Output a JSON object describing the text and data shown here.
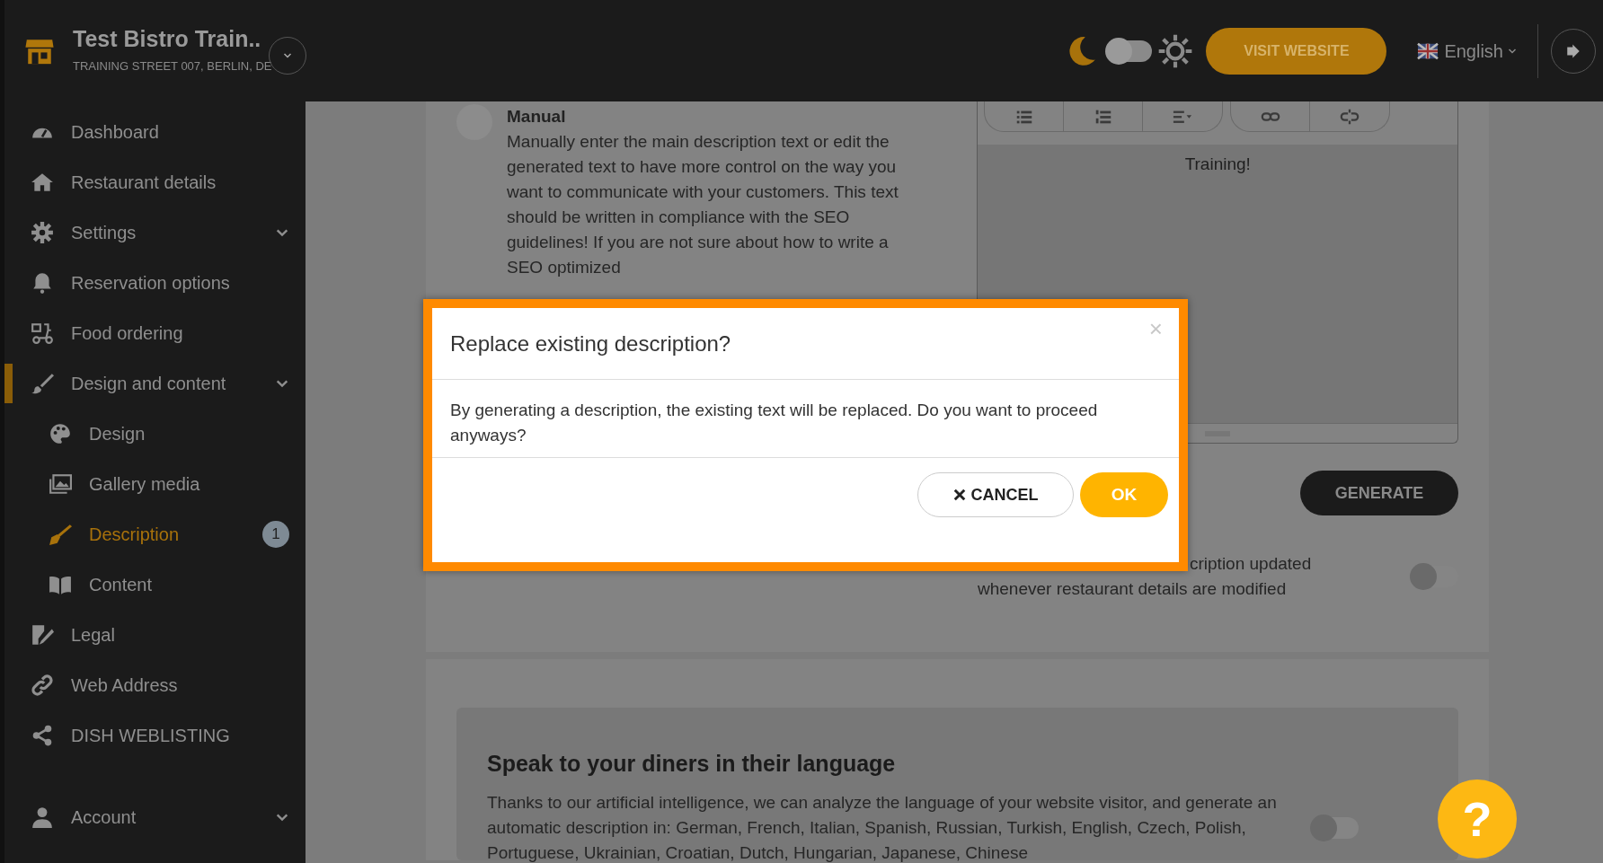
{
  "header": {
    "business_name": "Test Bistro Train..",
    "address": "TRAINING STREET 007, BERLIN, DE",
    "theme_toggle_on": false,
    "visit_button": "VISIT WEBSITE",
    "language": "English"
  },
  "sidebar": {
    "items": [
      {
        "label": "Dashboard",
        "expandable": false,
        "selected": false
      },
      {
        "label": "Restaurant details",
        "expandable": false,
        "selected": false
      },
      {
        "label": "Settings",
        "expandable": true,
        "selected": false
      },
      {
        "label": "Reservation options",
        "expandable": false,
        "selected": false
      },
      {
        "label": "Food ordering",
        "expandable": false,
        "selected": false
      },
      {
        "label": "Design and content",
        "expandable": true,
        "selected": true,
        "children": [
          {
            "label": "Design",
            "selected": false
          },
          {
            "label": "Gallery media",
            "selected": false
          },
          {
            "label": "Description",
            "selected": true,
            "badge": "1"
          },
          {
            "label": "Content",
            "selected": false
          }
        ]
      },
      {
        "label": "Legal",
        "expandable": false,
        "selected": false
      },
      {
        "label": "Web Address",
        "expandable": false,
        "selected": false
      },
      {
        "label": "DISH WEBLISTING",
        "expandable": false,
        "selected": false
      },
      {
        "label": "Account",
        "expandable": true,
        "selected": false
      }
    ]
  },
  "manual_option": {
    "selected": false,
    "title": "Manual",
    "text": "Manually enter the main description text or edit the generated text to have more control on the way you want to communicate with your customers. This text should be written in compliance with the SEO guidelines! If you are not sure about how to write a SEO optimized"
  },
  "editor": {
    "content": "Training!"
  },
  "generate_button": "GENERATE",
  "auto_update": {
    "lines": [
      "cription updated",
      "whenever restaurant details are modified"
    ],
    "on": false
  },
  "language_section": {
    "title": "Speak to your diners in their language",
    "text": "Thanks to our artificial intelligence, we can analyze the language of your website visitor, and generate an automatic description in: German, French, Italian, Spanish, Russian, Turkish, English, Czech, Polish, Portuguese, Ukrainian, Croatian, Dutch, Hungarian, Japanese, Chinese",
    "on": false
  },
  "dialog": {
    "title": "Replace existing description?",
    "close": "×",
    "message": "By generating a description, the existing text will be replaced. Do you want to proceed anyways?",
    "cancel": "CANCEL",
    "ok": "OK"
  },
  "help_button": "?"
}
